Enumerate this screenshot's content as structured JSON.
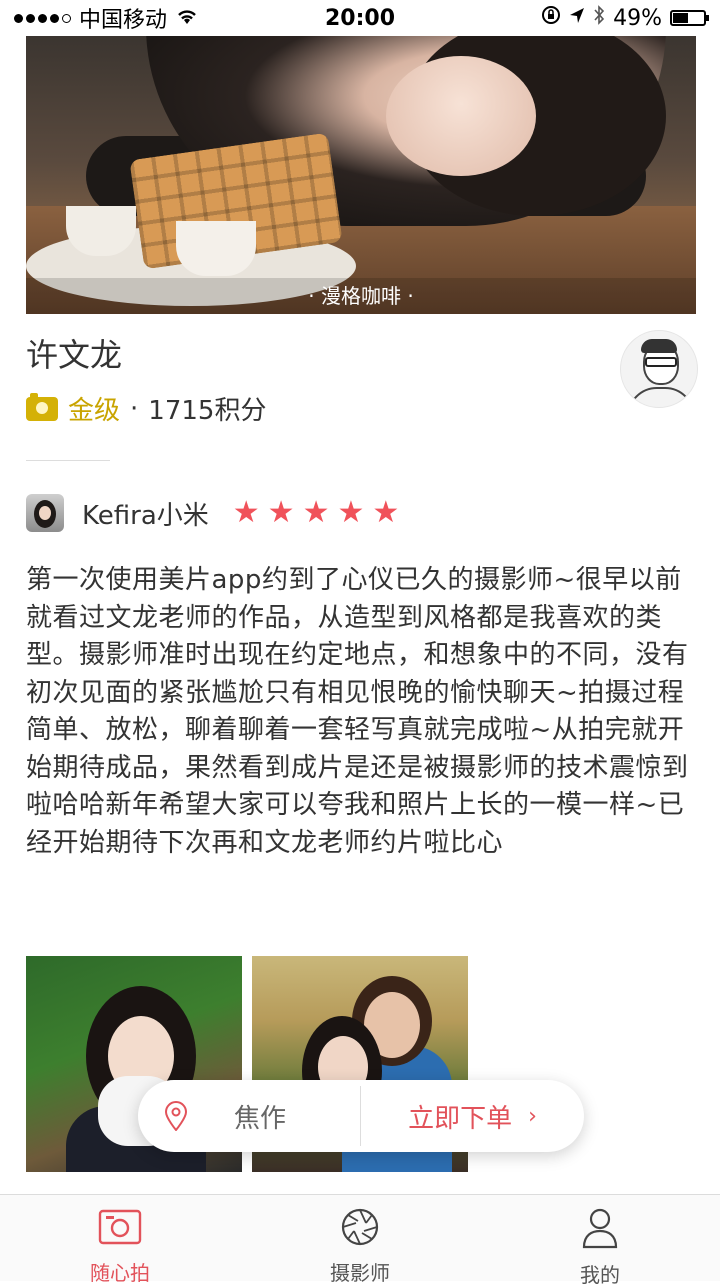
{
  "status_bar": {
    "carrier": "中国移动",
    "time": "20:00",
    "battery": "49%",
    "battery_level": 0.49
  },
  "hero": {
    "caption": "· 漫格咖啡 ·"
  },
  "photographer": {
    "name": "许文龙",
    "level": "金级",
    "separator": "·",
    "points": "1715积分"
  },
  "review": {
    "reviewer_name": "Kefira小米",
    "rating": 5,
    "text": "第一次使用美片app约到了心仪已久的摄影师~很早以前就看过文龙老师的作品，从造型到风格都是我喜欢的类型。摄影师准时出现在约定地点，和想象中的不同，没有初次见面的紧张尴尬只有相见恨晚的愉快聊天~拍摄过程简单、放松，聊着聊着一套轻写真就完成啦~从拍完就开始期待成品，果然看到成片是还是被摄影师的技术震惊到啦哈哈新年希望大家可以夸我和照片上长的一模一样~已经开始期待下次再和文龙老师约片啦比心"
  },
  "action_bar": {
    "works_label": "焦作",
    "order_label": "立即下单",
    "chevron": "›"
  },
  "tabs": [
    {
      "label": "随心拍",
      "icon": "camera-icon",
      "active": true
    },
    {
      "label": "摄影师",
      "icon": "aperture-icon",
      "active": false
    },
    {
      "label": "我的",
      "icon": "user-icon",
      "active": false
    }
  ],
  "colors": {
    "accent": "#e2525a",
    "gold": "#c9a400",
    "star": "#f0525a"
  }
}
